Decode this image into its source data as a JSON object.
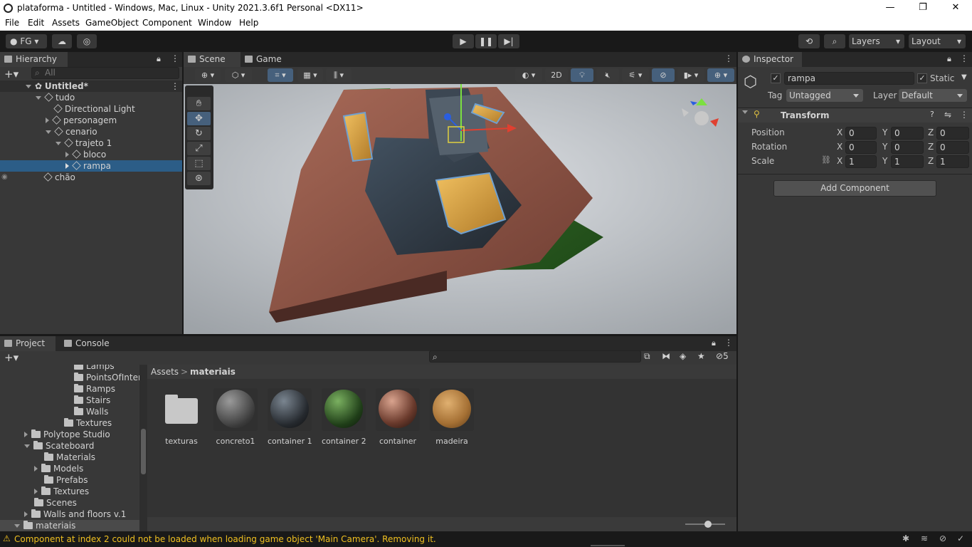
{
  "window": {
    "title": "plataforma - Untitled - Windows, Mac, Linux - Unity 2021.3.6f1 Personal <DX11>"
  },
  "menu": [
    "File",
    "Edit",
    "Assets",
    "GameObject",
    "Component",
    "Window",
    "Help"
  ],
  "toolbar": {
    "account": "FG",
    "layers": "Layers",
    "layout": "Layout"
  },
  "hierarchy": {
    "tab": "Hierarchy",
    "search_placeholder": "All",
    "items": [
      {
        "label": "Untitled*"
      },
      {
        "label": "tudo"
      },
      {
        "label": "Directional Light"
      },
      {
        "label": "personagem"
      },
      {
        "label": "cenario"
      },
      {
        "label": "trajeto 1"
      },
      {
        "label": "bloco"
      },
      {
        "label": "rampa"
      },
      {
        "label": "chão"
      }
    ]
  },
  "scene": {
    "tabs": [
      "Scene",
      "Game"
    ],
    "mode_2d": "2D"
  },
  "inspector": {
    "tab": "Inspector",
    "object_name": "rampa",
    "static_label": "Static",
    "tag_label": "Tag",
    "tag_value": "Untagged",
    "layer_label": "Layer",
    "layer_value": "Default",
    "component_title": "Transform",
    "rows": [
      {
        "label": "Position",
        "x": "0",
        "y": "0",
        "z": "0"
      },
      {
        "label": "Rotation",
        "x": "0",
        "y": "0",
        "z": "0"
      },
      {
        "label": "Scale",
        "x": "1",
        "y": "1",
        "z": "1"
      }
    ],
    "axis": {
      "x": "X",
      "y": "Y",
      "z": "Z"
    },
    "add_component": "Add Component"
  },
  "project": {
    "tabs": [
      "Project",
      "Console"
    ],
    "hidden_count": "5",
    "breadcrumb": {
      "root": "Assets",
      "sep": ">",
      "current": "materiais"
    },
    "tree": [
      {
        "label": "Lamps"
      },
      {
        "label": "PointsOfIntere"
      },
      {
        "label": "Ramps"
      },
      {
        "label": "Stairs"
      },
      {
        "label": "Walls"
      },
      {
        "label": "Textures"
      },
      {
        "label": "Polytope Studio"
      },
      {
        "label": "Scateboard"
      },
      {
        "label": "Materials"
      },
      {
        "label": "Models"
      },
      {
        "label": "Prefabs"
      },
      {
        "label": "Textures"
      },
      {
        "label": "Scenes"
      },
      {
        "label": "Walls and floors v.1"
      },
      {
        "label": "materiais"
      }
    ],
    "assets": [
      {
        "name": "texturas"
      },
      {
        "name": "concreto1"
      },
      {
        "name": "container 1"
      },
      {
        "name": "container 2"
      },
      {
        "name": "container"
      },
      {
        "name": "madeira"
      }
    ]
  },
  "status": {
    "message": "Component at index 2 could not be loaded when loading game object 'Main Camera'. Removing it."
  }
}
